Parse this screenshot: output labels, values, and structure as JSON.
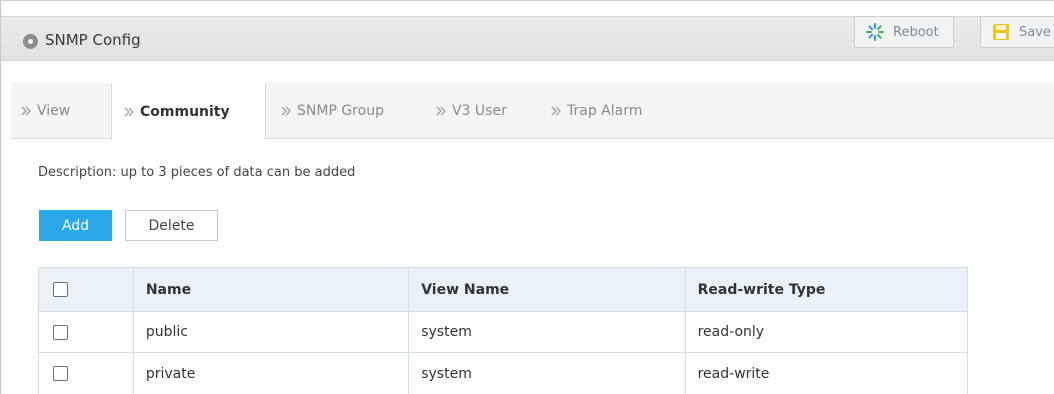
{
  "header": {
    "title": "SNMP Config",
    "title_icon": "circle-dot-icon",
    "reboot_label": "Reboot",
    "reboot_icon": "spinner-icon",
    "save_label": "Save",
    "save_icon": "floppy-disk-icon",
    "accent_color": "#2ba8e8",
    "save_icon_color": "#f2c21a"
  },
  "tabs": [
    {
      "label": "View",
      "active": false
    },
    {
      "label": "Community",
      "active": true
    },
    {
      "label": "SNMP Group",
      "active": false
    },
    {
      "label": "V3 User",
      "active": false
    },
    {
      "label": "Trap Alarm",
      "active": false
    }
  ],
  "main": {
    "description": "Description: up to 3 pieces of data can be added",
    "add_label": "Add",
    "delete_label": "Delete"
  },
  "table": {
    "columns": [
      "",
      "Name",
      "View Name",
      "Read-write Type"
    ],
    "rows": [
      {
        "checked": false,
        "name": "public",
        "view_name": "system",
        "rw_type": "read-only"
      },
      {
        "checked": false,
        "name": "private",
        "view_name": "system",
        "rw_type": "read-write"
      }
    ]
  }
}
